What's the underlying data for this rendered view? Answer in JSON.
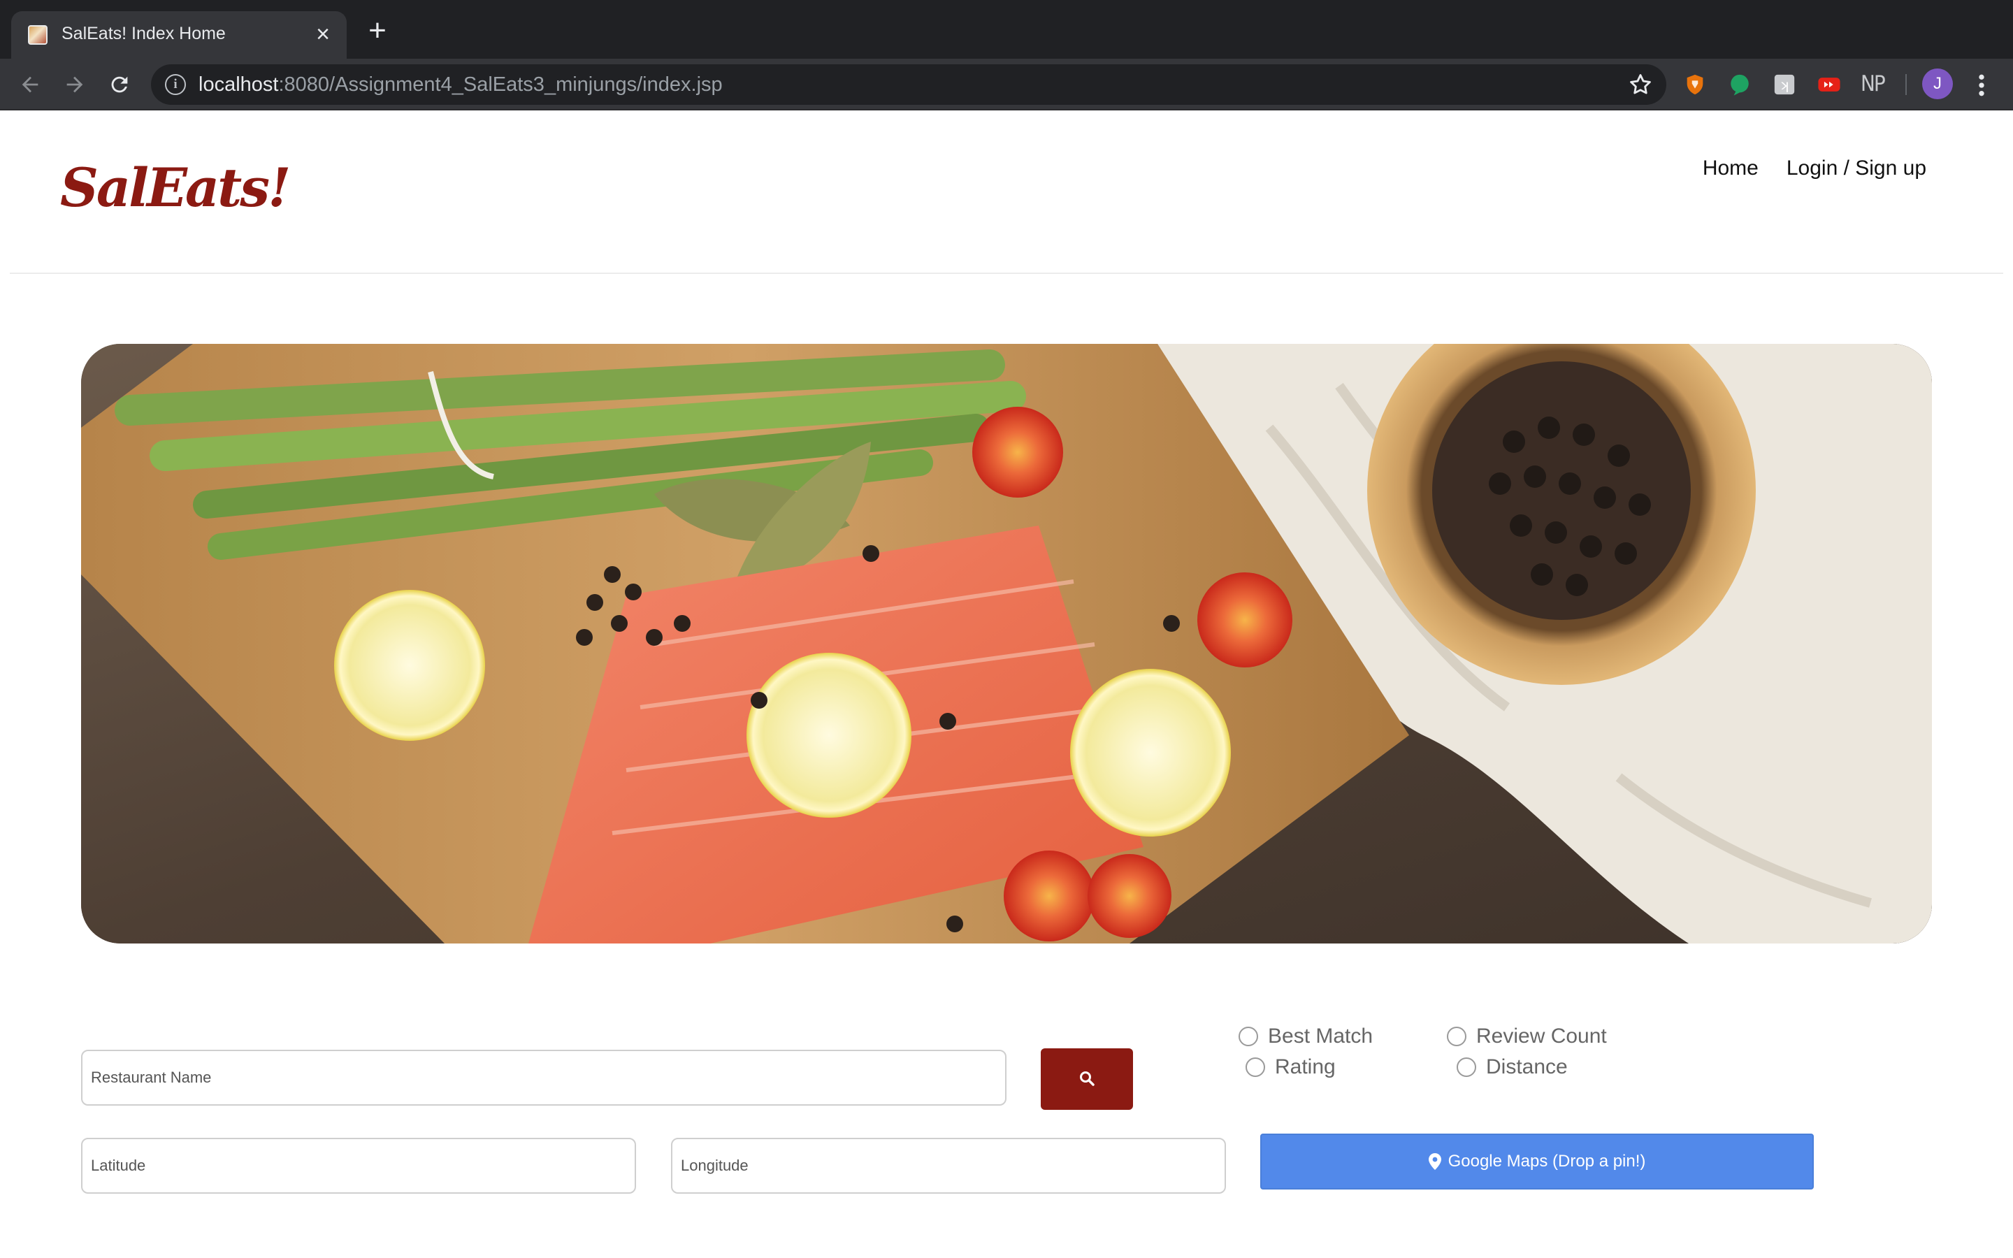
{
  "browser": {
    "tab_title": "SalEats! Index Home",
    "tab_close": "×",
    "new_tab": "+",
    "url_host": "localhost",
    "url_path": ":8080/Assignment4_SalEats3_minjungs/index.jsp",
    "info_icon": "i",
    "extensions": [
      "shield-extension-icon",
      "green-chat-extension-icon",
      "tile-extension-icon",
      "youtube-extension-icon",
      "np-extension"
    ],
    "np_label": "NP",
    "profile_initial": "J"
  },
  "site": {
    "logo": "SalEats!",
    "nav": {
      "home": "Home",
      "login": "Login / Sign up"
    },
    "brand_color": "#8b1a12"
  },
  "search": {
    "restaurant_placeholder": "Restaurant Name",
    "latitude_placeholder": "Latitude",
    "longitude_placeholder": "Longitude",
    "search_icon": "search-icon",
    "maps_label": "Google Maps (Drop a pin!)",
    "maps_color": "#5289ea",
    "sort_options": {
      "best_match": "Best Match",
      "review_count": "Review Count",
      "rating": "Rating",
      "distance": "Distance"
    }
  }
}
